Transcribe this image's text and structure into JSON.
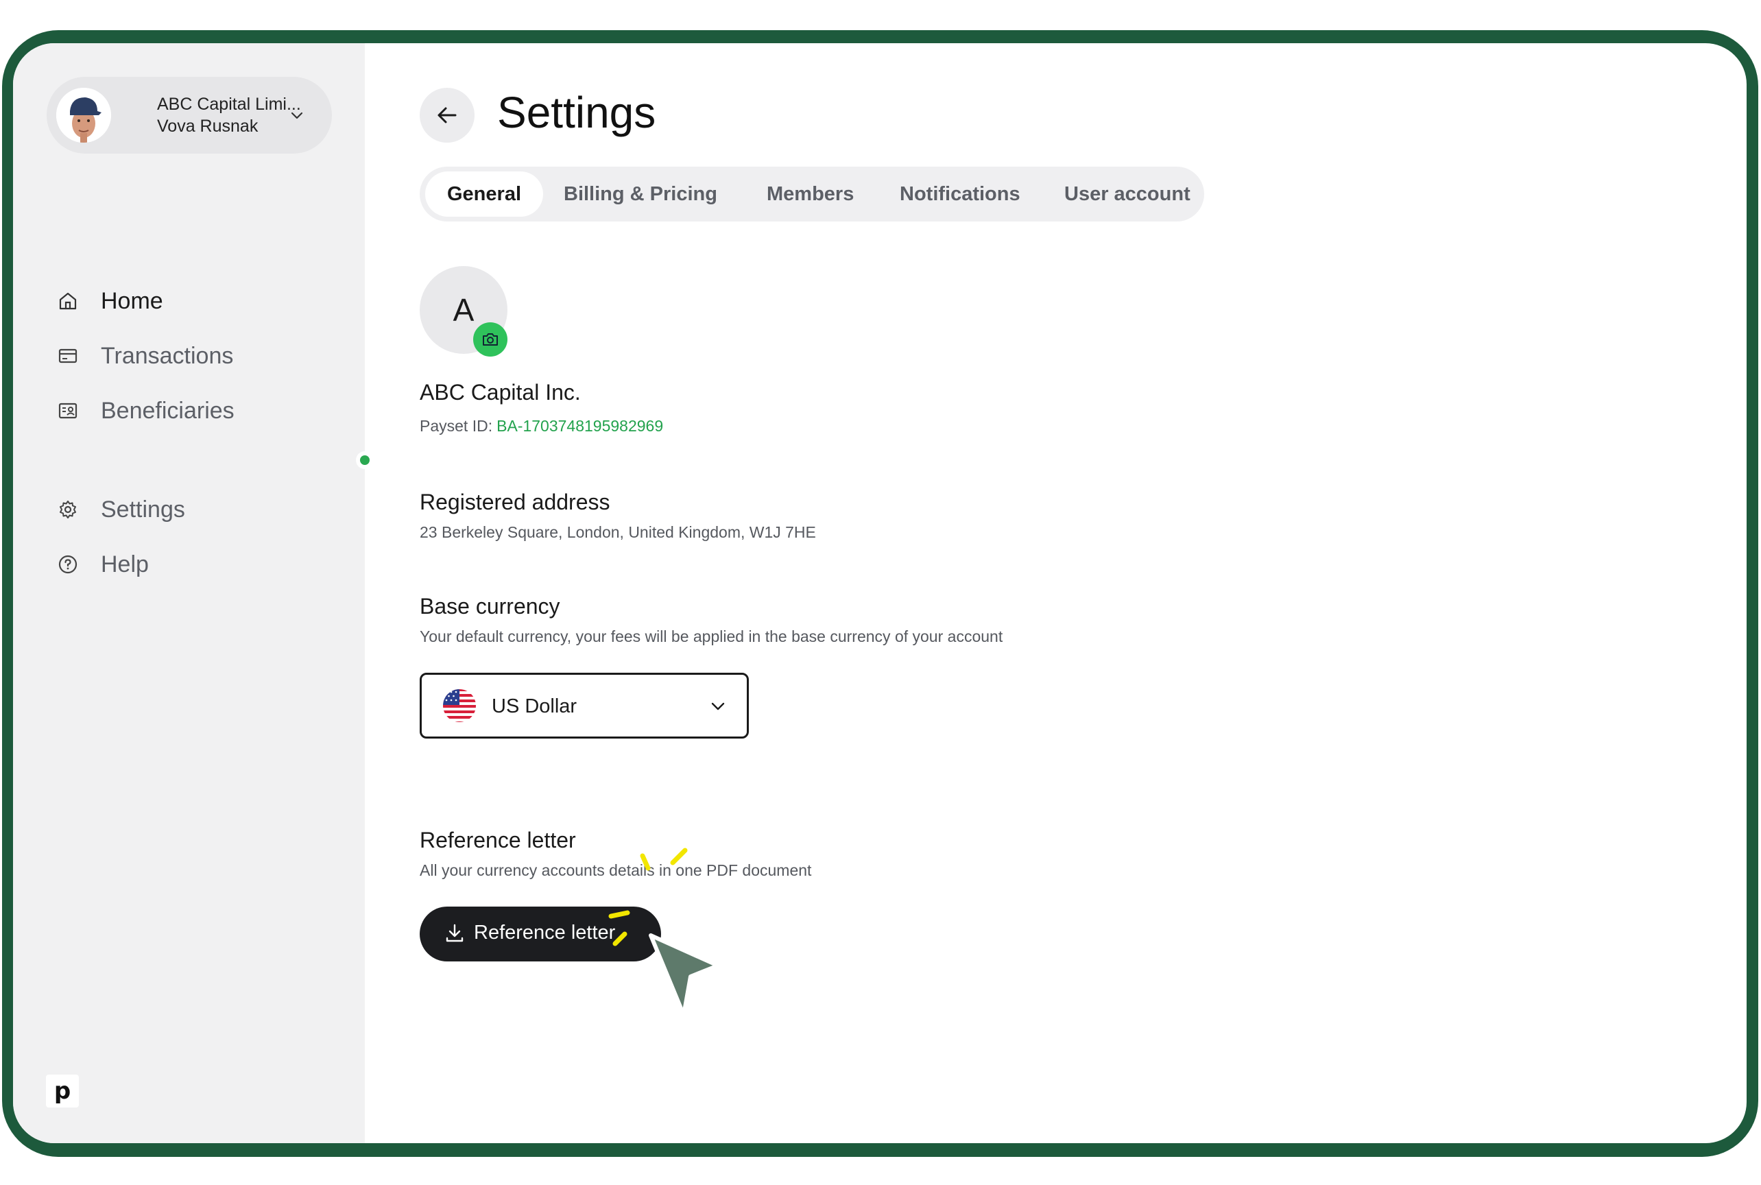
{
  "account": {
    "company": "ABC Capital Limi...",
    "user": "Vova Rusnak"
  },
  "nav": {
    "home": "Home",
    "transactions": "Transactions",
    "beneficiaries": "Beneficiaries",
    "settings": "Settings",
    "help": "Help"
  },
  "brand": {
    "logo": "p"
  },
  "header": {
    "title": "Settings"
  },
  "tabs": {
    "general": "General",
    "billing": "Billing & Pricing",
    "members": "Members",
    "notifications": "Notifications",
    "user_account": "User account"
  },
  "company": {
    "initial": "A",
    "name": "ABC Capital Inc.",
    "payset_label": "Payset ID:",
    "payset_id": "BA-1703748195982969"
  },
  "address": {
    "title": "Registered address",
    "value": "23 Berkeley Square, London, United Kingdom, W1J 7HE"
  },
  "currency": {
    "title": "Base currency",
    "description": "Your default currency, your fees will be applied in the base currency of your account",
    "selected": "US Dollar"
  },
  "reference": {
    "title": "Reference letter",
    "description": "All your currency accounts details in one PDF document",
    "button": "Reference letter"
  },
  "colors": {
    "frame": "#1d5a3c",
    "sidebar": "#f1f1f2",
    "accent_green": "#2fc25b",
    "id_green": "#23a24d",
    "button_dark": "#1c1d20",
    "cursor": "#5e7a6b",
    "highlight": "#f2e600"
  },
  "icons": [
    "home-icon",
    "card-icon",
    "contacts-icon",
    "gear-icon",
    "help-icon",
    "arrow-left-icon",
    "camera-icon",
    "chevron-down-icon",
    "us-flag-icon",
    "download-icon",
    "cursor-icon"
  ]
}
